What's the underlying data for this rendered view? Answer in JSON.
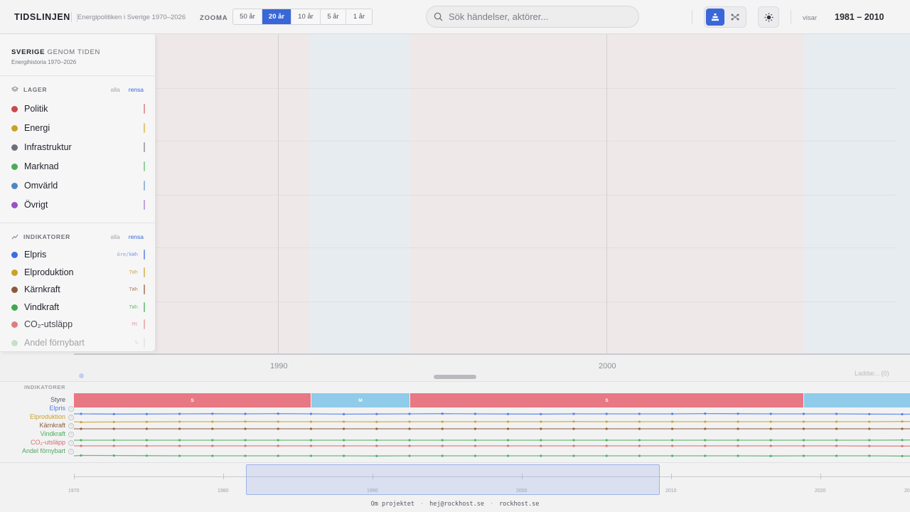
{
  "header": {
    "brand": "TIDSLINJEN",
    "subtitle": "Energipolitiken i Sverige 1970–2026",
    "zoom_label": "ZOOMA",
    "zoom_options": [
      "50 år",
      "20 år",
      "10 år",
      "5 år",
      "1 år"
    ],
    "zoom_active": "20 år",
    "search_placeholder": "Sök händelser, aktörer...",
    "showing_label": "visar",
    "range": "1981 – 2010"
  },
  "panel": {
    "title_bold": "SVERIGE",
    "title_rest": " GENOM TIDEN",
    "subtitle": "Energihistoria 1970–2026",
    "layers_heading": "LAGER",
    "indicators_heading": "INDIKATORER",
    "all_label": "alla",
    "clear_label": "rensa",
    "layers": [
      {
        "label": "Politik",
        "color": "#c9494f"
      },
      {
        "label": "Energi",
        "color": "#c9a227"
      },
      {
        "label": "Infrastruktur",
        "color": "#6f6f7a"
      },
      {
        "label": "Marknad",
        "color": "#4caa5a"
      },
      {
        "label": "Omvärld",
        "color": "#4f86c6"
      },
      {
        "label": "Övrigt",
        "color": "#9a52c4"
      }
    ],
    "indicators": [
      {
        "label": "Elpris",
        "unit": "öre/kWh",
        "color": "#3a6de0"
      },
      {
        "label": "Elproduktion",
        "unit": "TWh",
        "color": "#c9a227"
      },
      {
        "label": "Kärnkraft",
        "unit": "TWh",
        "color": "#8b5a3c"
      },
      {
        "label": "Vindkraft",
        "unit": "TWh",
        "color": "#3fa94f"
      },
      {
        "label": "CO₂-utsläpp",
        "unit": "Mt",
        "color": "#d86b6b"
      },
      {
        "label": "Andel förnybart",
        "unit": "%",
        "color": "#9ed09f"
      }
    ]
  },
  "timeline": {
    "tick_labels": [
      "1990",
      "2000"
    ],
    "loading": "Laddar... (0)"
  },
  "indicator_strip": {
    "title": "INDIKATORER",
    "rows": [
      {
        "label": "Styre",
        "color": "#555861"
      },
      {
        "label": "Elpris",
        "color": "#4a7bea"
      },
      {
        "label": "Elproduktion",
        "color": "#c9a227"
      },
      {
        "label": "Kärnkraft",
        "color": "#8b5a3c"
      },
      {
        "label": "Vindkraft",
        "color": "#48b05a"
      },
      {
        "label": "CO₂-utsläpp",
        "color": "#d86b6b"
      },
      {
        "label": "Andel förnybart",
        "color": "#52a864"
      }
    ],
    "government": [
      {
        "label": "S",
        "color": "#e87884"
      },
      {
        "label": "M",
        "color": "#90cbe9"
      },
      {
        "label": "S",
        "color": "#e87884"
      },
      {
        "label": "",
        "color": "#90cbe9"
      }
    ]
  },
  "overview": {
    "labels": [
      "1970",
      "1980",
      "1990",
      "2000",
      "2010",
      "2020",
      "20"
    ]
  },
  "footer": {
    "about": "Om projektet",
    "email": "hej@rockhost.se",
    "site": "rockhost.se",
    "separator": "·"
  }
}
